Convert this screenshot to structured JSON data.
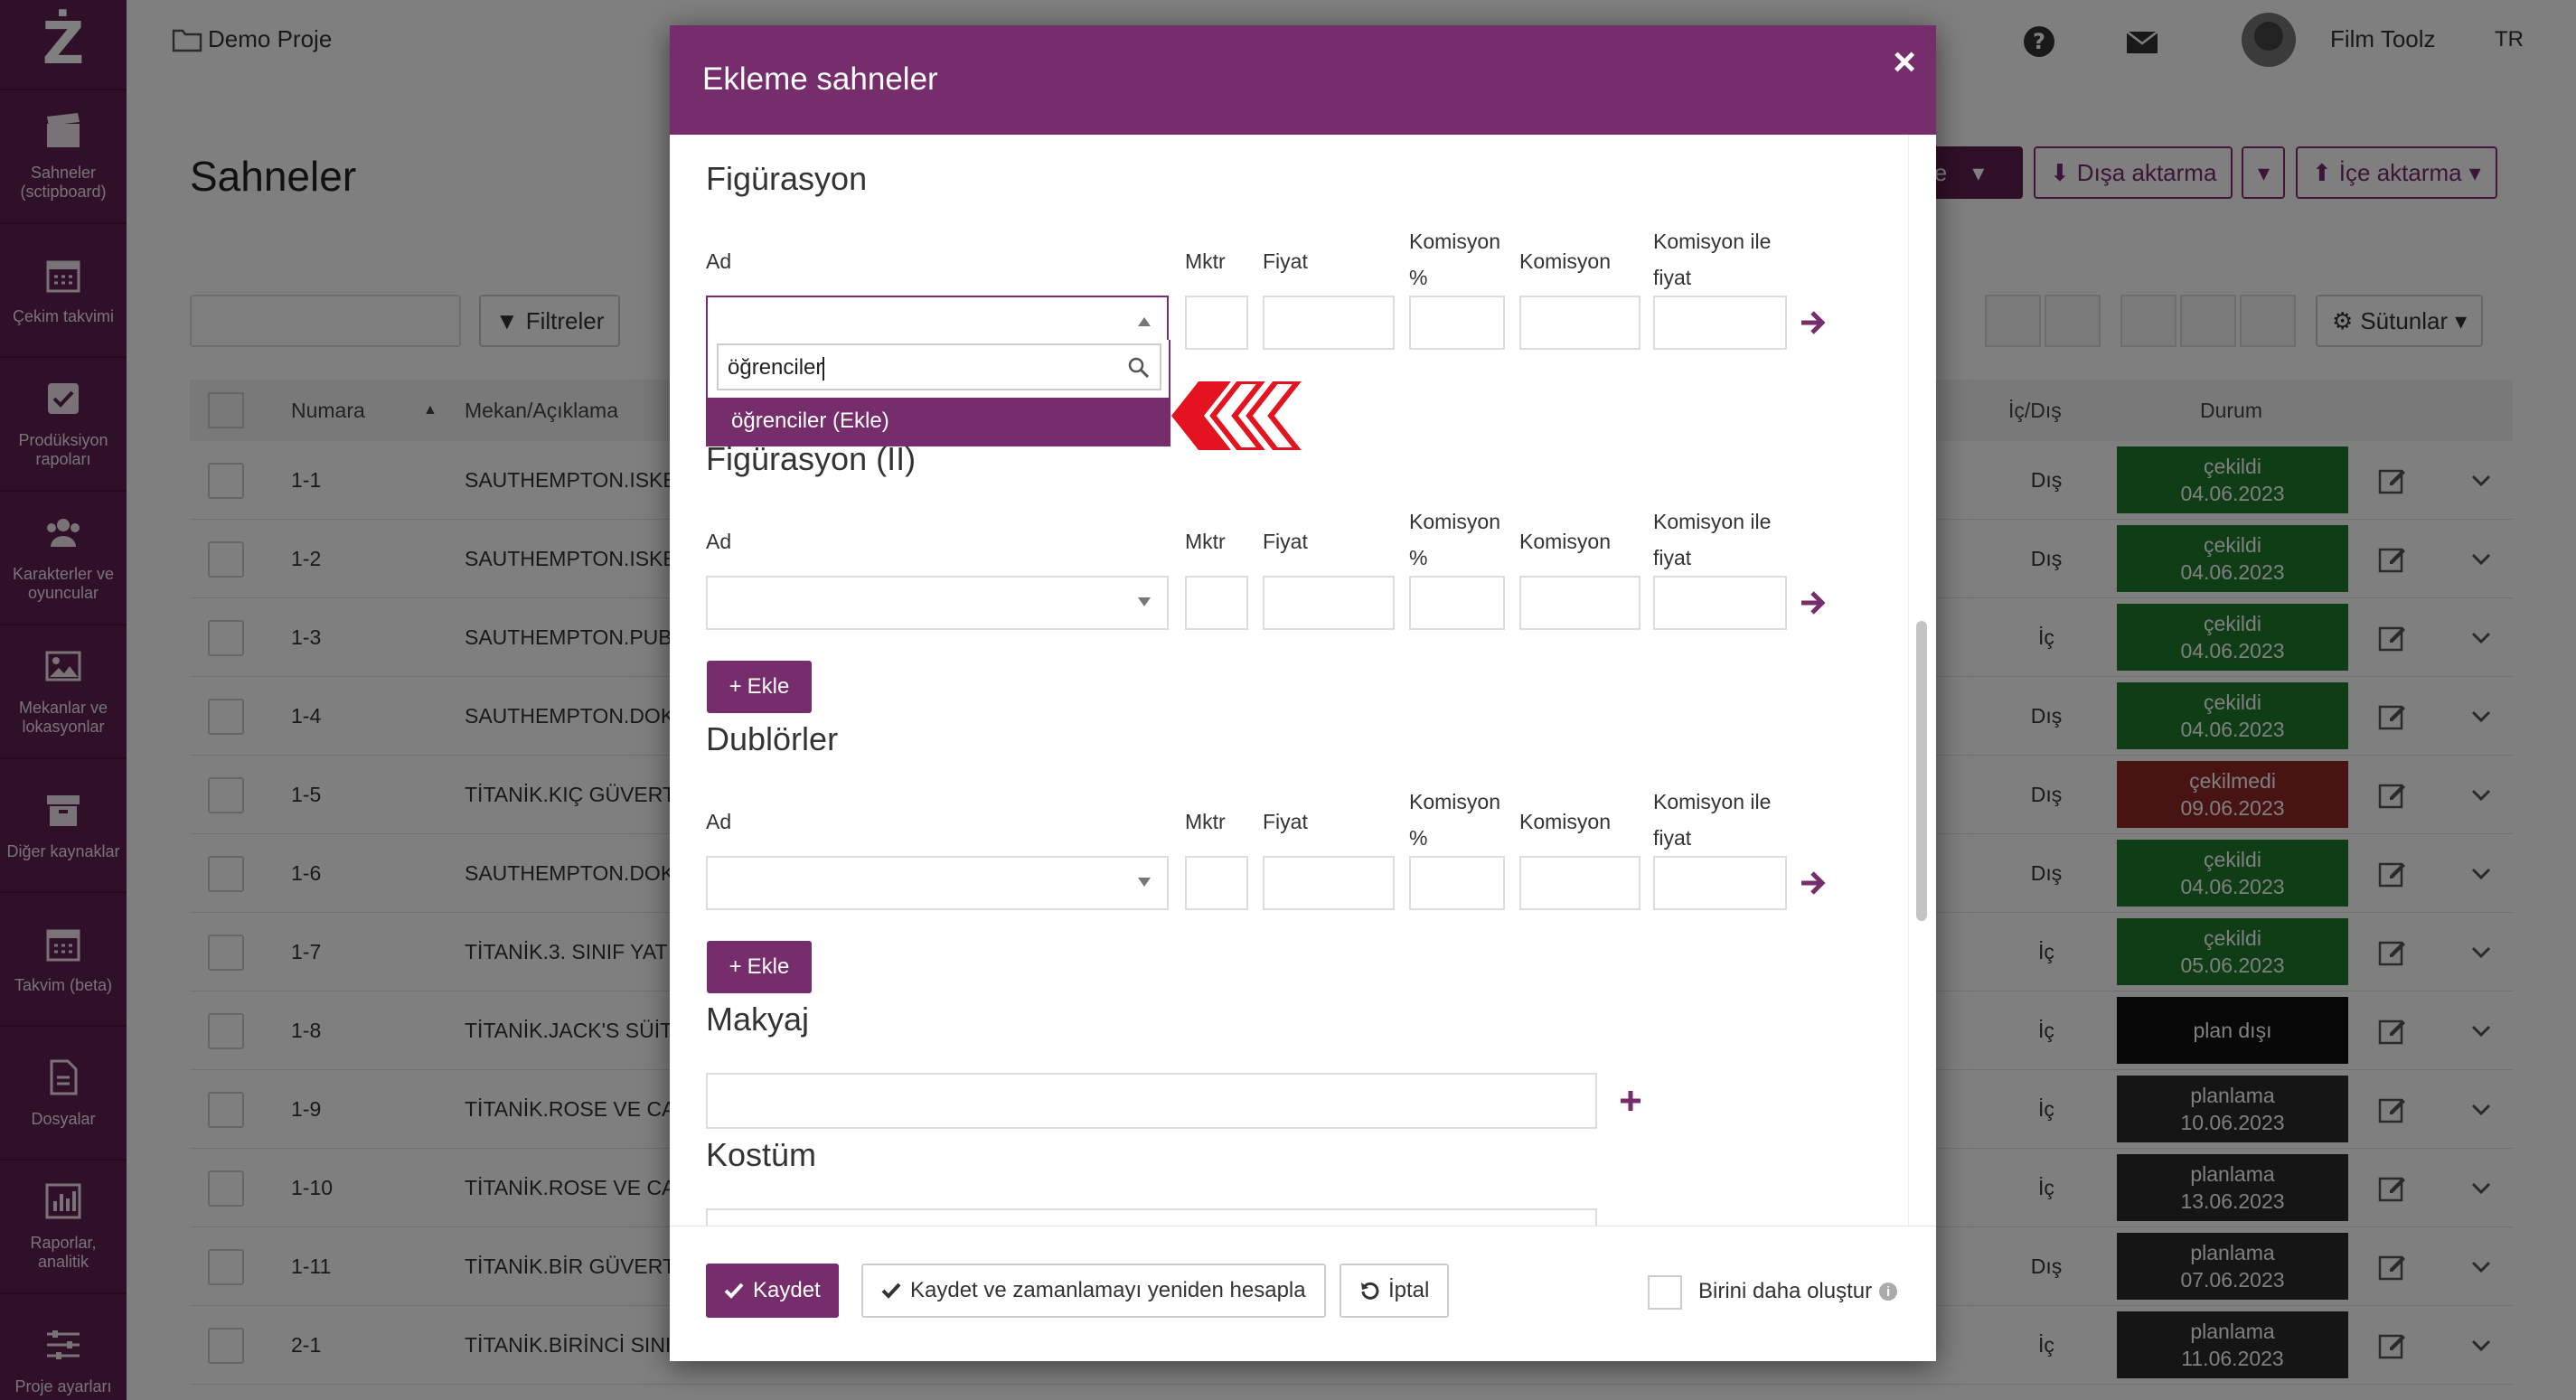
{
  "app": {
    "project_name": "Demo Proje",
    "user_name": "Film Toolz",
    "language": "TR"
  },
  "sidebar": {
    "items": [
      {
        "label": "Sahneler (sctipboard)",
        "icon": "clapperboard-icon"
      },
      {
        "label": "Çekim takvimi",
        "icon": "calendar-icon"
      },
      {
        "label": "Prodüksiyon rapoları",
        "icon": "checkbox-icon"
      },
      {
        "label": "Karakterler ve oyuncular",
        "icon": "users-icon"
      },
      {
        "label": "Mekanlar ve lokasyonlar",
        "icon": "image-icon"
      },
      {
        "label": "Diğer kaynaklar",
        "icon": "archive-icon"
      },
      {
        "label": "Takvim (beta)",
        "icon": "calendar-icon"
      },
      {
        "label": "Dosyalar",
        "icon": "file-icon"
      },
      {
        "label": "Raporlar, analitik",
        "icon": "bar-chart-icon"
      },
      {
        "label": "Proje ayarları",
        "icon": "sliders-icon"
      }
    ]
  },
  "page": {
    "title": "Sahneler",
    "export_label": "Dışa aktarma",
    "import_label": "İçe aktarma",
    "add_partial": "le",
    "filters_label": "Filtreler",
    "columns_label": "Sütunlar"
  },
  "table": {
    "headers": {
      "num": "Numara",
      "loc": "Mekan/Açıklama",
      "io": "İç/Dış",
      "status": "Durum"
    },
    "rows": [
      {
        "num": "1-1",
        "loc": "SAUTHEMPTON.ISKE",
        "io": "Dış",
        "status": "çekildi",
        "date": "04.06.2023",
        "color": "#1f7a2c"
      },
      {
        "num": "1-2",
        "loc": "SAUTHEMPTON.ISKE",
        "io": "Dış",
        "status": "çekildi",
        "date": "04.06.2023",
        "color": "#1f7a2c"
      },
      {
        "num": "1-3",
        "loc": "SAUTHEMPTON.PUB",
        "io": "İç",
        "status": "çekildi",
        "date": "04.06.2023",
        "color": "#1f7a2c"
      },
      {
        "num": "1-4",
        "loc": "SAUTHEMPTON.DOK",
        "io": "Dış",
        "status": "çekildi",
        "date": "04.06.2023",
        "color": "#1f7a2c"
      },
      {
        "num": "1-5",
        "loc": "TİTANİK.KIÇ GÜVERT",
        "io": "Dış",
        "status": "çekilmedi",
        "date": "09.06.2023",
        "color": "#8e2727"
      },
      {
        "num": "1-6",
        "loc": "SAUTHEMPTON.DOK",
        "io": "Dış",
        "status": "çekildi",
        "date": "04.06.2023",
        "color": "#1f7a2c"
      },
      {
        "num": "1-7",
        "loc": "TİTANİK.3. SINIF YAT",
        "io": "İç",
        "status": "çekildi",
        "date": "05.06.2023",
        "color": "#1f7a2c"
      },
      {
        "num": "1-8",
        "loc": "TİTANİK.JACK'S SÜİT",
        "io": "İç",
        "status": "plan dışı",
        "date": "",
        "color": "#111111"
      },
      {
        "num": "1-9",
        "loc": "TİTANİK.ROSE VE CA",
        "io": "İç",
        "status": "planlama",
        "date": "10.06.2023",
        "color": "#2b2b2b"
      },
      {
        "num": "1-10",
        "loc": "TİTANİK.ROSE VE CA",
        "io": "İç",
        "status": "planlama",
        "date": "13.06.2023",
        "color": "#2b2b2b"
      },
      {
        "num": "1-11",
        "loc": "TİTANİK.BİR GÜVERT",
        "io": "Dış",
        "status": "planlama",
        "date": "07.06.2023",
        "color": "#2b2b2b"
      },
      {
        "num": "2-1",
        "loc": "TİTANİK.BİRİNCİ SINI",
        "io": "İç",
        "status": "planlama",
        "date": "11.06.2023",
        "color": "#2b2b2b"
      }
    ]
  },
  "modal": {
    "title": "Ekleme sahneler",
    "close": "×",
    "cols": {
      "ad": "Ad",
      "mktr": "Mktr",
      "fiyat": "Fiyat",
      "komisyon_pct_1": "Komisyon",
      "komisyon_pct_2": "%",
      "komisyon": "Komisyon",
      "komisyon_fiyat_1": "Komisyon ile",
      "komisyon_fiyat_2": "fiyat"
    },
    "sections": {
      "figurasyon": "Figürasyon",
      "figurasyon2": "Figürasyon (II)",
      "dublorler": "Dublörler",
      "makyaj": "Makyaj",
      "kostum": "Kostüm"
    },
    "add_label": "Ekle",
    "dropdown": {
      "search_value": "öğrenciler",
      "option": "öğrenciler (Ekle)"
    },
    "footer": {
      "save": "Kaydet",
      "save_recalc": "Kaydet ve zamanlamayı yeniden hesapla",
      "cancel": "İptal",
      "create_another": "Birini daha oluştur"
    }
  },
  "colors": {
    "brand": "#762d6b",
    "sidebar": "#5e2151",
    "annotation_arrow": "#e3141f"
  }
}
